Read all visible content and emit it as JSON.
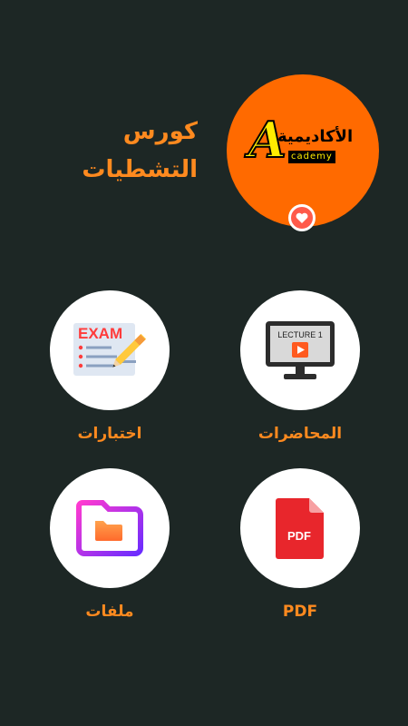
{
  "theme": {
    "background": "#1d2725",
    "accent": "#ff8a1f",
    "logo_bg": "#ff6a00",
    "white": "#ffffff"
  },
  "header": {
    "title_line1": "كورس",
    "title_line2": "التشطيات",
    "logo": {
      "big_letter": "A",
      "arabic_name": "الأكاديمية",
      "sub_text": "cademy"
    },
    "heart_icon": "heart-icon"
  },
  "menu": {
    "lectures": {
      "label": "المحاضرات",
      "icon": "lecture-video-icon",
      "icon_text": "LECTURE 1"
    },
    "exams": {
      "label": "اختبارات",
      "icon": "exam-checklist-icon",
      "icon_text": "EXAM"
    },
    "pdf": {
      "label": "PDF",
      "icon": "pdf-file-icon",
      "icon_text": "PDF"
    },
    "files": {
      "label": "ملفات",
      "icon": "folder-icon"
    }
  }
}
